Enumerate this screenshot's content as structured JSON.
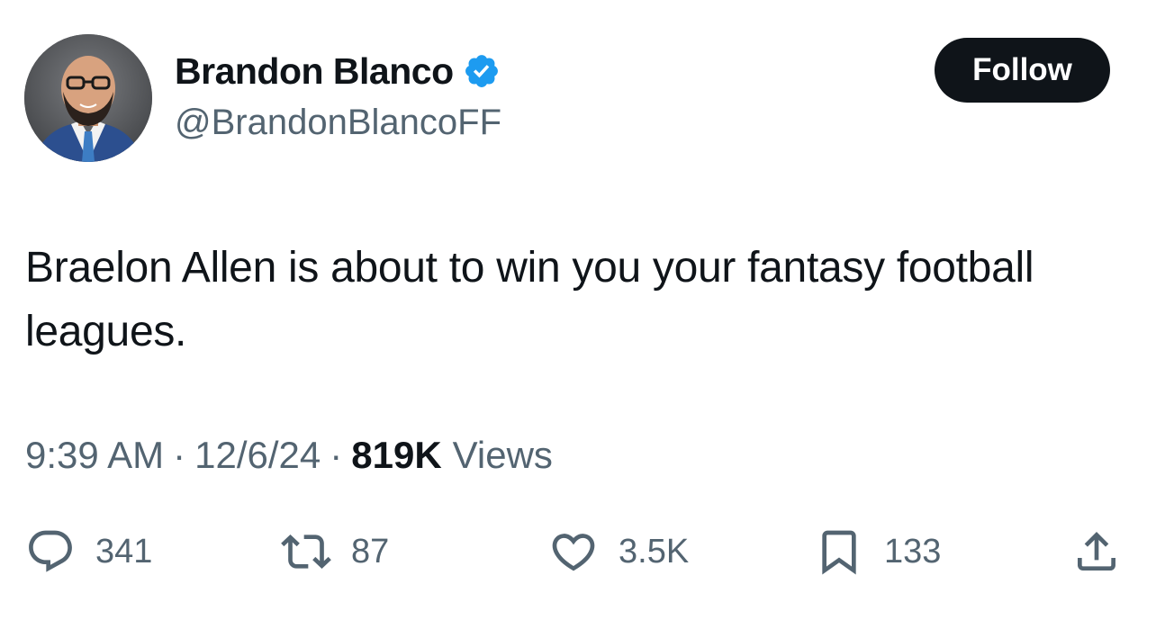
{
  "author": {
    "display_name": "Brandon Blanco",
    "handle": "@BrandonBlancoFF",
    "verified": true,
    "verified_color": "#1d9bf0"
  },
  "follow_button": {
    "label": "Follow",
    "bg_color": "#0f1419",
    "text_color": "#ffffff"
  },
  "tweet": {
    "text": "Braelon Allen is about to win you your fantasy football leagues."
  },
  "meta": {
    "time": "9:39 AM",
    "separator": "·",
    "date": "12/6/24",
    "views_count": "819K",
    "views_label": "Views"
  },
  "actions": {
    "replies": "341",
    "retweets": "87",
    "likes": "3.5K",
    "bookmarks": "133"
  },
  "icons": {
    "reply": "reply-icon",
    "retweet": "retweet-icon",
    "like": "heart-icon",
    "bookmark": "bookmark-icon",
    "share": "share-icon",
    "verified": "verified-badge-icon"
  },
  "colors": {
    "text_primary": "#0f1419",
    "text_secondary": "#536471",
    "background": "#ffffff"
  }
}
